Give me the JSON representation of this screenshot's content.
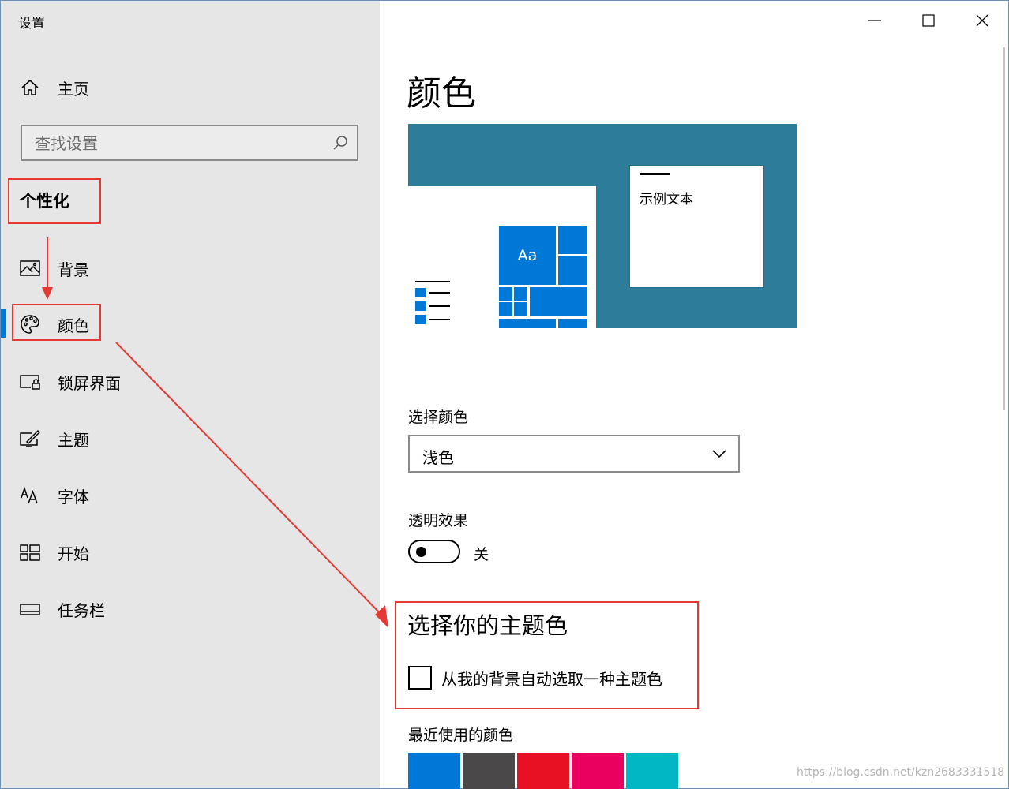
{
  "app": {
    "title": "设置"
  },
  "sidebar": {
    "home_label": "主页",
    "search_placeholder": "查找设置",
    "section": "个性化",
    "items": [
      {
        "label": "背景",
        "icon": "picture-icon"
      },
      {
        "label": "颜色",
        "icon": "palette-icon"
      },
      {
        "label": "锁屏界面",
        "icon": "lock-screen-icon"
      },
      {
        "label": "主题",
        "icon": "theme-brush-icon"
      },
      {
        "label": "字体",
        "icon": "font-icon"
      },
      {
        "label": "开始",
        "icon": "start-tiles-icon"
      },
      {
        "label": "任务栏",
        "icon": "taskbar-icon"
      }
    ],
    "active_item": "颜色"
  },
  "main": {
    "title": "颜色",
    "preview": {
      "sample_text": "示例文本",
      "tile_label": "Aa"
    },
    "choose_color_label": "选择颜色",
    "choose_color_value": "浅色",
    "transparency_label": "透明效果",
    "transparency_state": "关",
    "accent_title": "选择你的主题色",
    "auto_accent_label": "从我的背景自动选取一种主题色",
    "recent_colors_label": "最近使用的颜色"
  },
  "colors": {
    "accent": "#0078d7",
    "preview_background": "#2d7d9a",
    "annotation": "#e53935",
    "recent": [
      "#0078d7",
      "#4a4848",
      "#e81123",
      "#ea005e",
      "#00b7c3"
    ]
  },
  "watermark": "https://blog.csdn.net/kzn2683331518"
}
